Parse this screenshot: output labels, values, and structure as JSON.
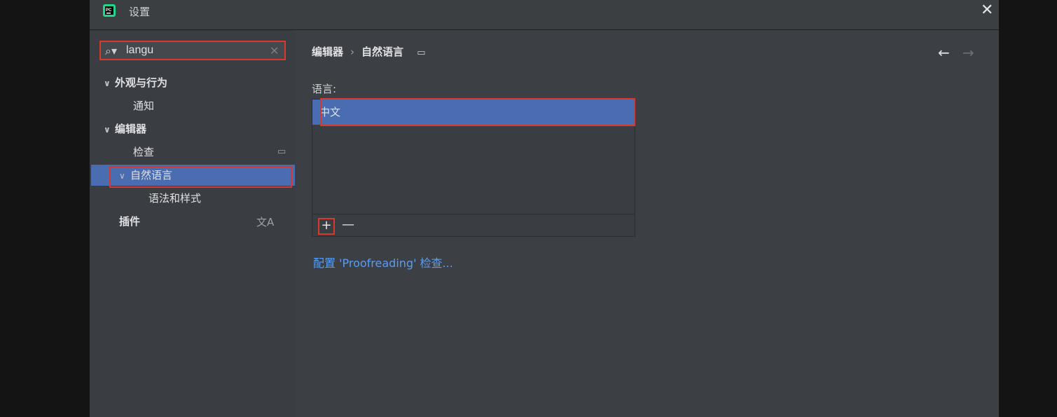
{
  "window": {
    "title": "设置",
    "close_icon": "close-icon"
  },
  "colors": {
    "accent": "#4a6db1",
    "highlight_border": "#d8392b",
    "link": "#589df6"
  },
  "search": {
    "value": "langu",
    "icon": "search-icon",
    "clear_icon": "clear-icon"
  },
  "sidebar": {
    "items": [
      {
        "label": "外观与行为"
      },
      {
        "label": "通知"
      },
      {
        "label": "编辑器"
      },
      {
        "label": "检查"
      },
      {
        "label": "自然语言"
      },
      {
        "label": "语法和样式"
      },
      {
        "label": "插件"
      }
    ]
  },
  "main": {
    "breadcrumb": {
      "parent": "编辑器",
      "separator": "›",
      "current": "自然语言"
    },
    "languages_label": "语言:",
    "languages": [
      "中文"
    ],
    "add_label": "+",
    "remove_label": "—",
    "config_link": "配置 'Proofreading' 检查..."
  }
}
